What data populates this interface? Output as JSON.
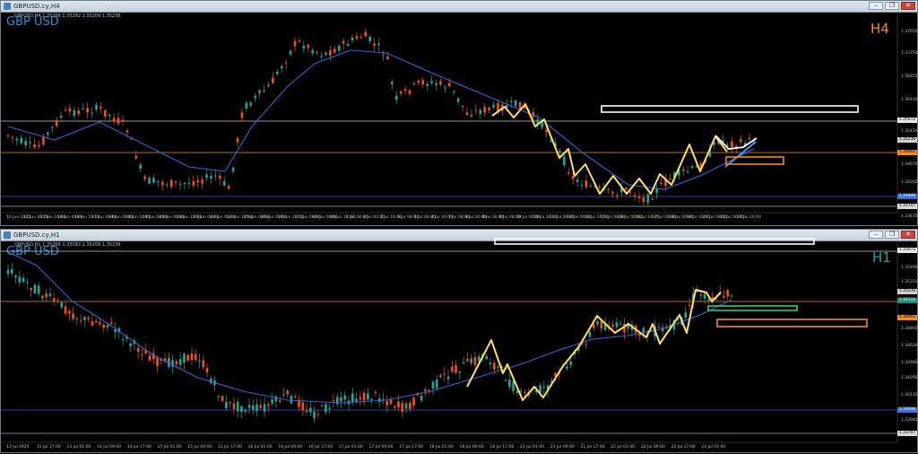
{
  "colors": {
    "bull": "#26a69a",
    "bear": "#f4511e",
    "ma": "#3f5fd6",
    "zigzag": "#ffe066",
    "white": "#ffffff",
    "orange": "#f28c1e",
    "green": "#2ecc71",
    "blueline": "#3b56d9"
  },
  "h4": {
    "title": "GBPUSD.cy,H4",
    "ohlc": "GBPUSD,H4 1.35266 1.35282 1.35209 1.35236",
    "symbol": "GBP USD",
    "timeframe": "H4",
    "price_labels": [
      "1.37650",
      "1.37250",
      "1.36815",
      "1.36410",
      "1.35410",
      "1.34670",
      "1.34260",
      "1.33670"
    ],
    "price_tags": {
      "white": "1.35672",
      "cur": "1.35236",
      "orange": "1.34902",
      "blue": "1.33946",
      "bottom": "1.33707"
    },
    "time_labels": [
      "10 Jun 2025",
      "11 Jun 08:00",
      "12 Jun 16:00",
      "16 Jun 00:00",
      "16 Jun 16:00",
      "17 Jun 08:00",
      "18 Jun 00:00",
      "18 Jun 16:00",
      "19 Jun 08:00",
      "20 Jun 00:00",
      "20 Jun 16:00",
      "23 Jun 08:00",
      "24 Jun 00:00",
      "24 Jun 16:00",
      "25 Jun 08:00",
      "26 Jun 00:00",
      "26 Jun 16:00",
      "27 Jun 08:00",
      "30 Jun 00:00",
      "30 Jun 16:00",
      "1 Jul 08:00",
      "2 Jul 00:00",
      "2 Jul 16:00",
      "3 Jul 08:00",
      "4 Jul 00:00",
      "4 Jul 16:00",
      "7 Jul 08:00",
      "8 Jul 00:00",
      "8 Jul 16:00",
      "9 Jul 08:00",
      "10 Jul 00:00",
      "10 Jul 16:00",
      "11 Jul 08:00",
      "14 Jul 00:00",
      "14 Jul 16:00",
      "15 Jul 08:00",
      "16 Jul 00:00",
      "16 Jul 16:00",
      "17 Jul 08:00",
      "18 Jul 00:00",
      "18 Jul 16:00",
      "21 Jul 08:00",
      "22 Jul 00:00",
      "22 Jul 16:00"
    ]
  },
  "h1": {
    "title": "GBPUSD.cy,H1",
    "ohlc": "GBPUSD,H1 1.35266 1.35282 1.35209 1.35236",
    "symbol": "GBP USD",
    "timeframe": "H1",
    "price_labels": [
      "1.35490",
      "1.35310",
      "1.34800",
      "1.34630",
      "1.34460",
      "1.34290",
      "1.34110",
      "1.33940"
    ],
    "price_tags": {
      "top": "1.35672",
      "cur": "1.35236",
      "green": "1.35133",
      "orange": "1.34902",
      "blue": "1.33946",
      "bottom": "1.33707"
    },
    "time_labels": [
      "11 Jul 2025",
      "11 Jul 17:00",
      "14 Jul 01:00",
      "14 Jul 09:00",
      "14 Jul 17:00",
      "15 Jul 01:00",
      "15 Jul 09:00",
      "15 Jul 17:00",
      "16 Jul 01:00",
      "16 Jul 09:00",
      "16 Jul 17:00",
      "17 Jul 01:00",
      "17 Jul 09:00",
      "17 Jul 17:00",
      "18 Jul 01:00",
      "18 Jul 09:00",
      "18 Jul 17:00",
      "21 Jul 01:00",
      "21 Jul 09:00",
      "21 Jul 17:00",
      "22 Jul 01:00",
      "22 Jul 09:00",
      "22 Jul 17:00",
      "23 Jul 01:00"
    ]
  }
}
